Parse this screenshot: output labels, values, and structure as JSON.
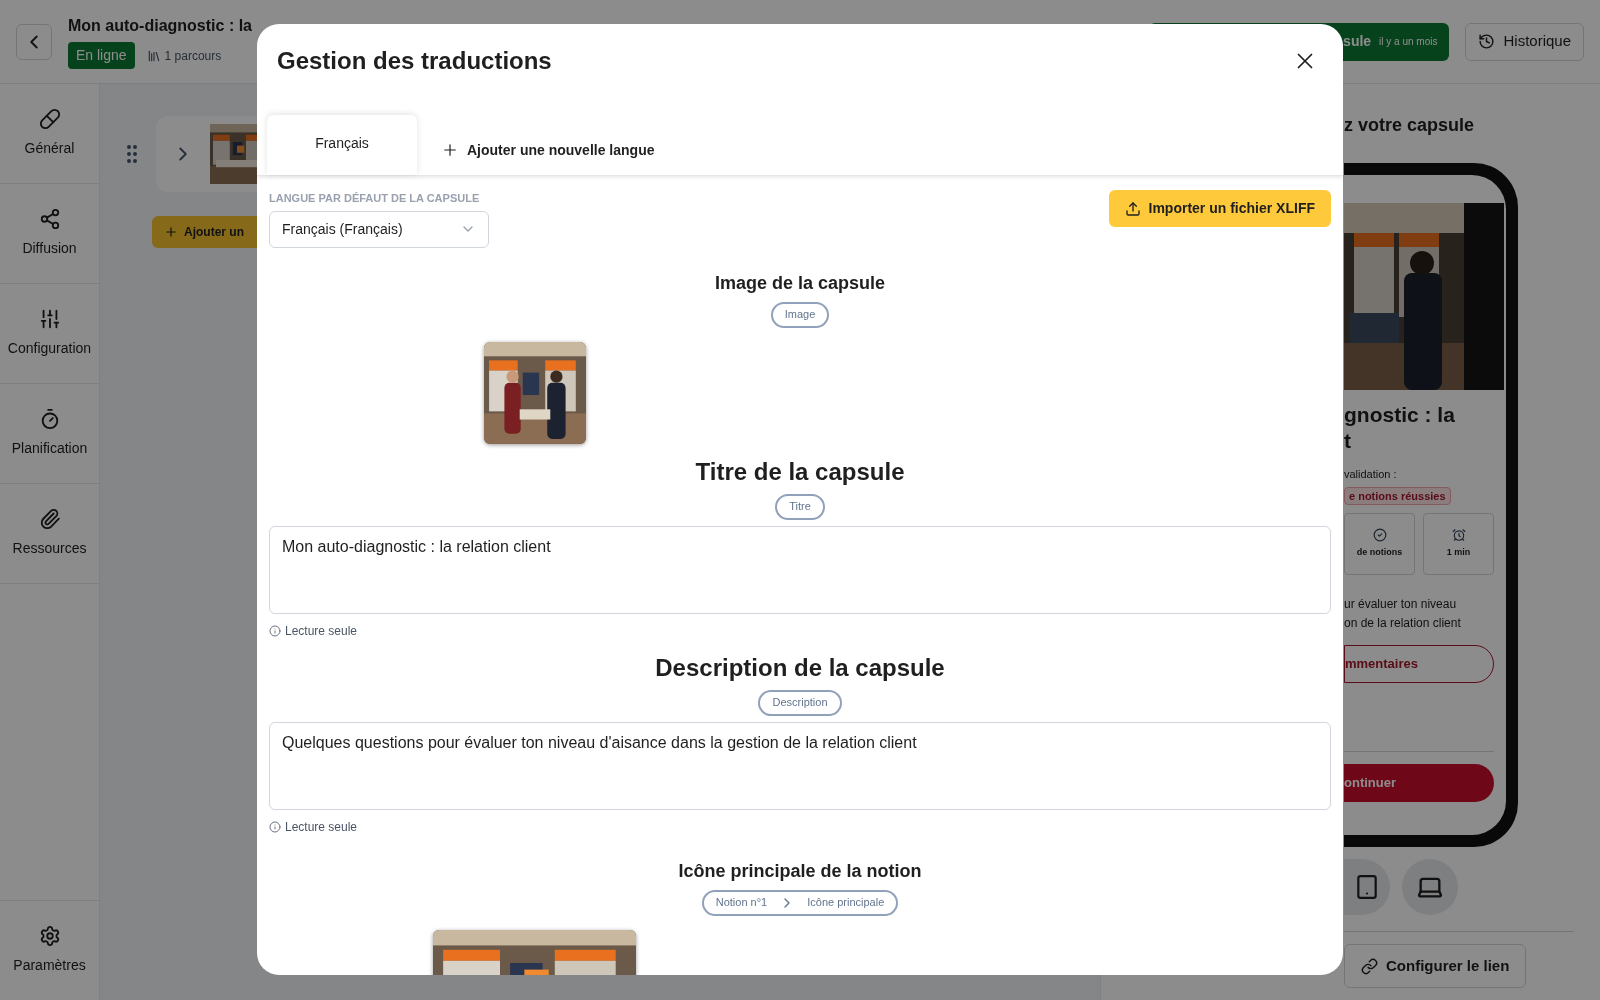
{
  "top_bar": {
    "title": "Mon auto-diagnostic : la",
    "status": "En ligne",
    "parcours": "1 parcours",
    "publish_button": {
      "label": "sule",
      "time": "il y a un mois"
    },
    "history_button": "Historique"
  },
  "sidebar": {
    "items": [
      {
        "label": "Général"
      },
      {
        "label": "Diffusion"
      },
      {
        "label": "Configuration"
      },
      {
        "label": "Planification"
      },
      {
        "label": "Ressources"
      }
    ],
    "settings": "Paramètres"
  },
  "content": {
    "add_button": "Ajouter un"
  },
  "preview": {
    "heading": "z votre capsule",
    "title_lines": [
      "gnostic : la",
      "t"
    ],
    "validation_label": "validation :",
    "validation_badge": "e notions réussies",
    "stats": [
      "de notions",
      "1 min"
    ],
    "description_lines": [
      "ur évaluer ton niveau",
      "on de la relation client"
    ],
    "comments_button": "mmentaires",
    "continue_button": "ontinuer",
    "link_button": "Configurer le lien"
  },
  "modal": {
    "title": "Gestion des traductions",
    "tabs": [
      {
        "label": "Français",
        "selected": true
      }
    ],
    "add_language": "Ajouter une nouvelle langue",
    "default_language_label": "LANGUE PAR DÉFAUT DE LA CAPSULE",
    "default_language": "Français (Français)",
    "import_button": "Importer un fichier XLIFF",
    "sections": [
      {
        "title": "Image de la capsule",
        "tags": [
          "Image"
        ]
      },
      {
        "kind": "text",
        "title": "Titre de la capsule",
        "tags": [
          "Titre"
        ],
        "value": "Mon auto-diagnostic : la relation client",
        "note": "Lecture seule"
      },
      {
        "kind": "text",
        "title": "Description de la capsule",
        "tags": [
          "Description"
        ],
        "value": "Quelques questions pour évaluer ton niveau d'aisance dans la gestion de la relation client",
        "note": "Lecture seule"
      },
      {
        "title": "Icône principale de la notion",
        "tags": [
          "Notion n°1",
          "Icône principale"
        ]
      }
    ]
  }
}
